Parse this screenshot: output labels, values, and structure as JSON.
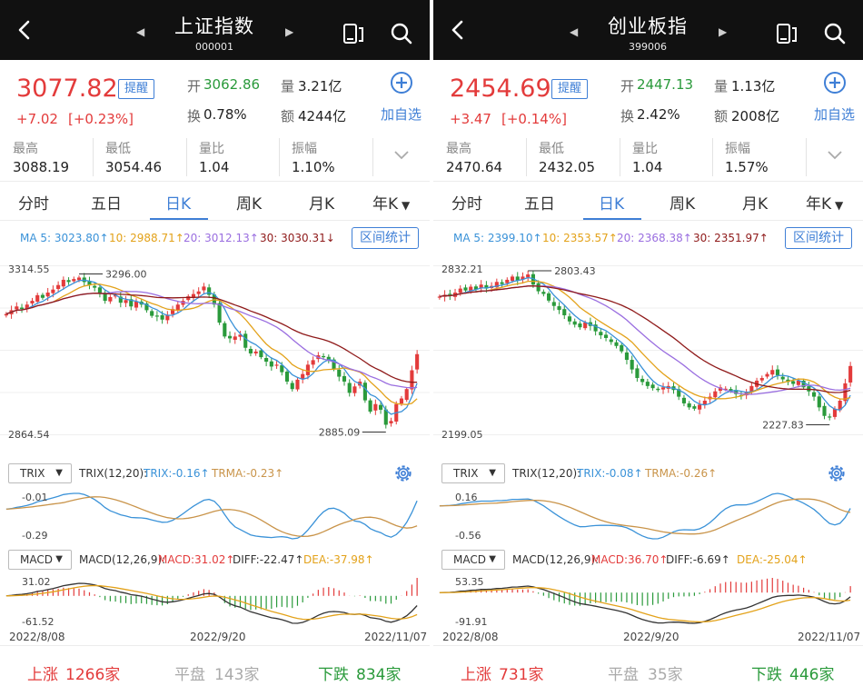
{
  "colors": {
    "up": "#e33b3b",
    "down": "#2a9a3b",
    "accent": "#3f7fd6",
    "ma5": "#3a92d8",
    "ma10": "#e3a21a",
    "ma20": "#9a6ee0",
    "ma30": "#8f1a1a",
    "trix": "#3a92d8",
    "trma": "#c9944a",
    "diff": "#333333",
    "dea": "#e3a21a"
  },
  "panels": [
    {
      "title": "上证指数",
      "code": "000001",
      "price": "3077.82",
      "remind": "提醒",
      "chg": "+7.02",
      "chg_pct": "[+0.23%]",
      "open_lbl": "开",
      "open": "3062.86",
      "vol_lbl": "量",
      "vol": "3.21亿",
      "turn_lbl": "换",
      "turn": "0.78%",
      "amt_lbl": "额",
      "amt": "4244亿",
      "add": "加自选",
      "stats": [
        {
          "label": "最高",
          "value": "3088.19"
        },
        {
          "label": "最低",
          "value": "3054.46"
        },
        {
          "label": "量比",
          "value": "1.04"
        },
        {
          "label": "振幅",
          "value": "1.10%"
        }
      ],
      "tabs": [
        "分时",
        "五日",
        "日K",
        "周K",
        "月K",
        "年K"
      ],
      "ma5": "MA 5: 3023.80↑",
      "ma10": "10: 2988.71↑",
      "ma20": "20: 3012.13↑",
      "ma30": "30: 3030.31↓",
      "stat_btn": "区间统计",
      "k_top": "3314.55",
      "k_high_lbl": "3296.00",
      "k_low_lbl": "2885.09",
      "k_bottom": "2864.54",
      "trix_sel": "TRIX",
      "trix_param": "TRIX(12,20):",
      "trix_val": "TRIX:-0.16↑",
      "trma_val": "TRMA:-0.23↑",
      "trix_top": "-0.01",
      "trix_bottom": "-0.29",
      "macd_sel": "MACD",
      "macd_param": "MACD(12,26,9):",
      "macd_val": "MACD:31.02↑",
      "diff_val": "DIFF:-22.47↑",
      "dea_val": "DEA:-37.98↑",
      "macd_top": "31.02",
      "macd_bottom": "-61.52",
      "dates": [
        "2022/8/08",
        "2022/9/20",
        "2022/11/07"
      ],
      "up_lbl": "上涨",
      "up": "1266家",
      "flat_lbl": "平盘",
      "flat": "143家",
      "down_lbl": "下跌",
      "down": "834家",
      "chart_data": {
        "type": "candlestick",
        "y_range": [
          2864.54,
          3314.55
        ],
        "close": [
          3185,
          3195,
          3205,
          3198,
          3210,
          3220,
          3235,
          3228,
          3242,
          3250,
          3262,
          3276,
          3270,
          3278,
          3282,
          3270,
          3262,
          3255,
          3238,
          3220,
          3230,
          3235,
          3215,
          3222,
          3205,
          3218,
          3210,
          3195,
          3180,
          3178,
          3170,
          3183,
          3198,
          3210,
          3220,
          3232,
          3238,
          3245,
          3258,
          3236,
          3210,
          3162,
          3125,
          3120,
          3125,
          3130,
          3095,
          3080,
          3085,
          3070,
          3058,
          3045,
          3050,
          3030,
          3005,
          2985,
          3010,
          3025,
          3050,
          3062,
          3075,
          3070,
          3060,
          3038,
          3018,
          3005,
          2975,
          2992,
          3005,
          2955,
          2925,
          2945,
          2930,
          2890,
          2900,
          2945,
          2960,
          2985,
          3035,
          3078
        ]
      }
    },
    {
      "title": "创业板指",
      "code": "399006",
      "price": "2454.69",
      "remind": "提醒",
      "chg": "+3.47",
      "chg_pct": "[+0.14%]",
      "open_lbl": "开",
      "open": "2447.13",
      "vol_lbl": "量",
      "vol": "1.13亿",
      "turn_lbl": "换",
      "turn": "2.42%",
      "amt_lbl": "额",
      "amt": "2008亿",
      "add": "加自选",
      "stats": [
        {
          "label": "最高",
          "value": "2470.64"
        },
        {
          "label": "最低",
          "value": "2432.05"
        },
        {
          "label": "量比",
          "value": "1.04"
        },
        {
          "label": "振幅",
          "value": "1.57%"
        }
      ],
      "tabs": [
        "分时",
        "五日",
        "日K",
        "周K",
        "月K",
        "年K"
      ],
      "ma5": "MA 5: 2399.10↑",
      "ma10": "10: 2353.57↑",
      "ma20": "20: 2368.38↑",
      "ma30": "30: 2351.97↑",
      "stat_btn": "区间统计",
      "k_top": "2832.21",
      "k_high_lbl": "2803.43",
      "k_low_lbl": "2227.83",
      "k_bottom": "2199.05",
      "trix_sel": "TRIX",
      "trix_param": "TRIX(12,20):",
      "trix_val": "TRIX:-0.08↑",
      "trma_val": "TRMA:-0.26↑",
      "trix_top": "0.16",
      "trix_bottom": "-0.56",
      "macd_sel": "MACD",
      "macd_param": "MACD(12,26,9):",
      "macd_val": "MACD:36.70↑",
      "diff_val": "DIFF:-6.69↑",
      "dea_val": "DEA:-25.04↑",
      "macd_top": "53.35",
      "macd_bottom": "-91.91",
      "dates": [
        "2022/8/08",
        "2022/9/20",
        "2022/11/07"
      ],
      "up_lbl": "上涨",
      "up": "731家",
      "flat_lbl": "平盘",
      "flat": "35家",
      "down_lbl": "下跌",
      "down": "446家",
      "chart_data": {
        "type": "candlestick",
        "y_range": [
          2199.05,
          2832.21
        ],
        "close": [
          2715,
          2722,
          2718,
          2730,
          2745,
          2738,
          2752,
          2742,
          2760,
          2745,
          2755,
          2770,
          2762,
          2778,
          2790,
          2775,
          2790,
          2798,
          2760,
          2735,
          2725,
          2700,
          2680,
          2665,
          2645,
          2622,
          2610,
          2600,
          2618,
          2605,
          2585,
          2570,
          2560,
          2545,
          2530,
          2510,
          2478,
          2442,
          2410,
          2395,
          2380,
          2372,
          2365,
          2375,
          2380,
          2365,
          2340,
          2315,
          2300,
          2295,
          2310,
          2325,
          2340,
          2360,
          2375,
          2370,
          2362,
          2350,
          2345,
          2355,
          2380,
          2400,
          2410,
          2425,
          2440,
          2420,
          2405,
          2395,
          2388,
          2400,
          2375,
          2360,
          2340,
          2300,
          2268,
          2262,
          2295,
          2325,
          2390,
          2455
        ]
      }
    }
  ]
}
